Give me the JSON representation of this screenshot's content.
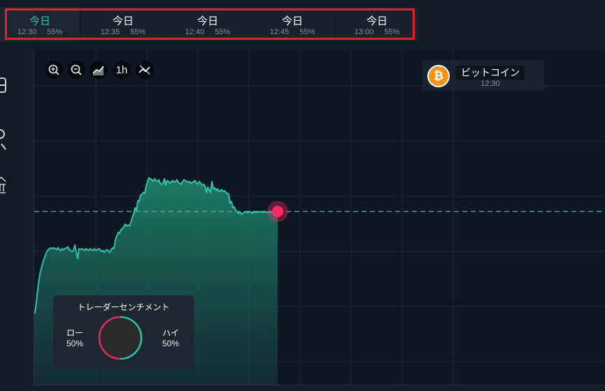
{
  "expiry_tabs": [
    {
      "day": "今日",
      "time": "12:30",
      "payout": "55%",
      "active": true
    },
    {
      "day": "今日",
      "time": "12:35",
      "payout": "55%",
      "active": false
    },
    {
      "day": "今日",
      "time": "12:40",
      "payout": "55%",
      "active": false
    },
    {
      "day": "今日",
      "time": "12:45",
      "payout": "55%",
      "active": false
    },
    {
      "day": "今日",
      "time": "13:00",
      "payout": "55%",
      "active": false
    }
  ],
  "toolbar": {
    "zoom_in_icon": "zoom-in-icon",
    "zoom_out_icon": "zoom-out-icon",
    "chart_type_icon": "chart-type-icon",
    "timeframe": "1h",
    "indicators_icon": "indicators-icon"
  },
  "asset": {
    "name": "ビットコイン",
    "time": "12:30",
    "logo_glyph": "₿",
    "logo_color": "#f7931a"
  },
  "sentiment": {
    "title": "トレーダーセンチメント",
    "low_label": "ロー",
    "low_value": "50%",
    "high_label": "ハイ",
    "high_value": "50%",
    "low_share": 0.5,
    "low_color": "#f0285a",
    "high_color": "#2ec4a0"
  },
  "colors": {
    "accent": "#2ec4a0",
    "current_price_marker": "#ff2a63",
    "tab_highlight": "#e0222b"
  },
  "chart_data": {
    "type": "area",
    "x": [
      0,
      2,
      4,
      6,
      8,
      10,
      12,
      14,
      16,
      18,
      20,
      22,
      24,
      26,
      28,
      30,
      32,
      34,
      36,
      38,
      40,
      42,
      44,
      46,
      48,
      50,
      52,
      54,
      56,
      58,
      60,
      62,
      64,
      66,
      68,
      70,
      72,
      74,
      76,
      78,
      80,
      82,
      84,
      86,
      88,
      90,
      92,
      94,
      96,
      98,
      100,
      102,
      104,
      106,
      108,
      110,
      112,
      114,
      116,
      118,
      120,
      122,
      124,
      126,
      128,
      130,
      132,
      134,
      136,
      138,
      140,
      142,
      144,
      146,
      148,
      150,
      152,
      154,
      156,
      158,
      160,
      162,
      164,
      166,
      168,
      170,
      172,
      174,
      176,
      178,
      180,
      182,
      184,
      186,
      188,
      190,
      192,
      194,
      196,
      198,
      200,
      202,
      204,
      206,
      208,
      210,
      212,
      214,
      216,
      218,
      220,
      222,
      224,
      226,
      228,
      230,
      232,
      234,
      236,
      238,
      240,
      242,
      244,
      246,
      248,
      250,
      252,
      254,
      256,
      258,
      260,
      262,
      264,
      266,
      268,
      270,
      272,
      274,
      276,
      278,
      280,
      282,
      284,
      286,
      288,
      290,
      292,
      294,
      296,
      298,
      300,
      302,
      304,
      306,
      308,
      310,
      312,
      314,
      316,
      318,
      320,
      322,
      324,
      326,
      328,
      330,
      332,
      334,
      336,
      338,
      340,
      342,
      344,
      346,
      348
    ],
    "values": [
      14,
      20,
      35,
      48,
      58,
      64,
      70,
      75,
      79,
      83,
      85,
      86,
      87,
      86,
      87,
      86,
      85,
      87,
      85,
      84,
      86,
      85,
      86,
      87,
      88,
      85,
      84,
      83,
      84,
      90,
      82,
      75,
      86,
      85,
      86,
      85,
      84,
      86,
      85,
      84,
      86,
      85,
      84,
      86,
      84,
      85,
      86,
      85,
      83,
      84,
      82,
      84,
      85,
      83,
      82,
      85,
      87,
      86,
      96,
      100,
      104,
      103,
      107,
      108,
      110,
      113,
      111,
      112,
      111,
      115,
      120,
      124,
      131,
      128,
      139,
      138,
      145,
      146,
      148,
      147,
      155,
      160,
      164,
      163,
      162,
      160,
      163,
      161,
      160,
      162,
      158,
      157,
      158,
      163,
      156,
      161,
      160,
      158,
      160,
      161,
      159,
      160,
      162,
      159,
      158,
      157,
      160,
      162,
      161,
      160,
      159,
      160,
      158,
      159,
      160,
      161,
      158,
      157,
      160,
      158,
      156,
      157,
      155,
      148,
      154,
      151,
      148,
      160,
      152,
      153,
      150,
      152,
      149,
      150,
      151,
      149,
      150,
      148,
      147,
      146,
      136,
      138,
      131,
      132,
      128,
      127,
      125,
      126,
      124,
      125,
      126,
      127,
      126,
      126,
      127,
      126,
      125,
      127,
      126,
      126,
      127,
      126,
      127,
      126,
      126,
      127,
      126,
      126,
      127,
      126,
      127,
      126,
      126,
      127,
      126,
      126,
      127,
      126
    ],
    "current_price": 127
  }
}
